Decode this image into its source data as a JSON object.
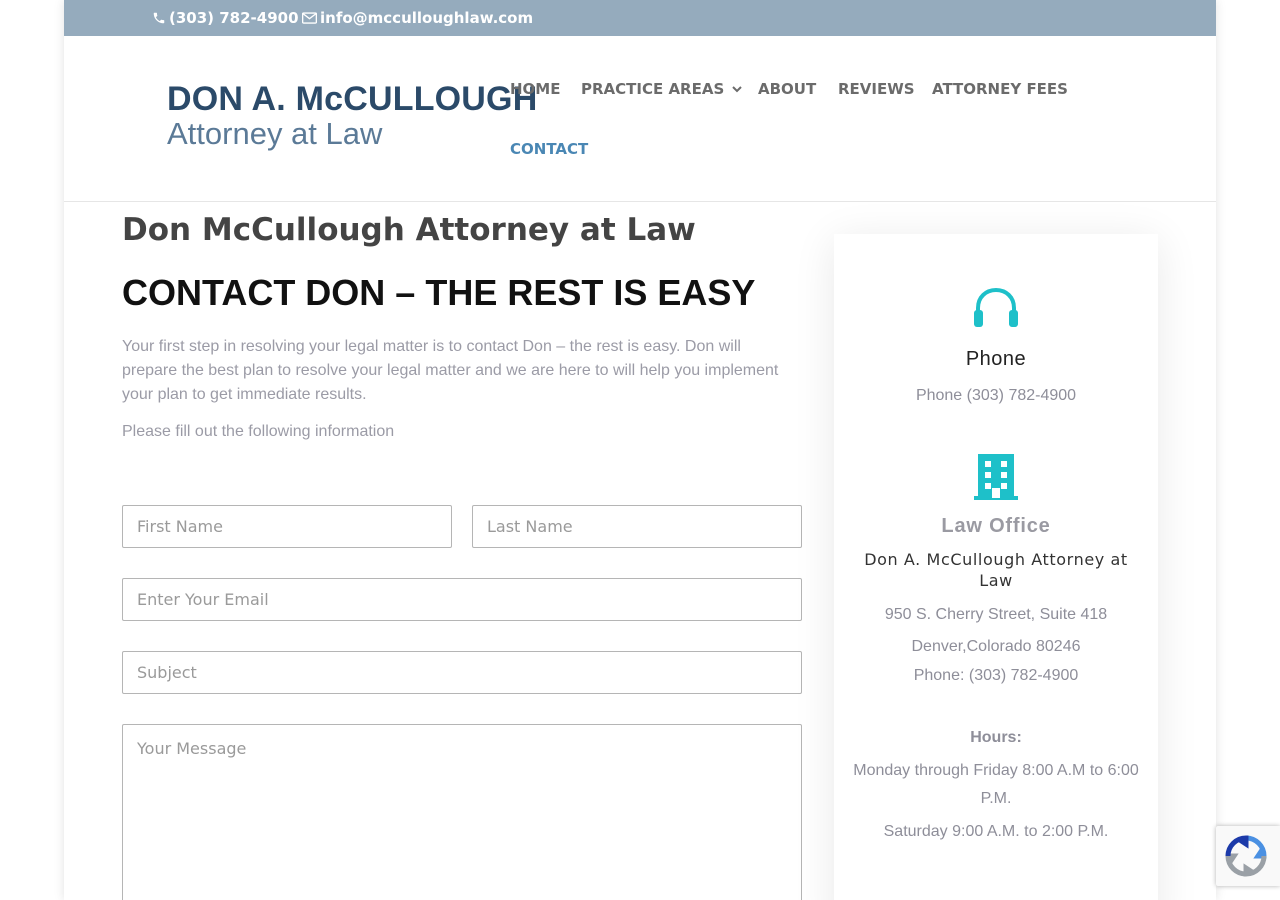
{
  "topbar": {
    "phone": "(303) 782-4900",
    "email": "info@mcculloughlaw.com"
  },
  "logo": {
    "line1": "DON A. McCULLOUGH",
    "line2": "Attorney at Law"
  },
  "nav": {
    "home": "HOME",
    "practice_areas": "PRACTICE AREAS",
    "about": "ABOUT",
    "reviews": "REVIEWS",
    "attorney_fees": "ATTORNEY FEES",
    "contact": "CONTACT"
  },
  "main": {
    "page_title": "Don McCullough Attorney at Law",
    "heading": "CONTACT DON – THE REST IS EASY",
    "intro": "Your first step in resolving your legal matter is to contact Don – the rest is easy. Don will prepare the best plan to resolve your legal matter and we are here to will help you implement your plan to get immediate results.",
    "instructions": "Please fill out the following information"
  },
  "form": {
    "first_name_placeholder": "First Name",
    "last_name_placeholder": "Last Name",
    "email_placeholder": "Enter Your Email",
    "subject_placeholder": "Subject",
    "message_placeholder": "Your Message"
  },
  "sidebar": {
    "phone_title": "Phone",
    "phone_text": "Phone (303) 782-4900",
    "office_title": "Law Office",
    "office_name": "Don A. McCullough Attorney at Law",
    "address_line1": "950 S. Cherry Street, Suite 418",
    "address_line2": "Denver,Colorado 80246",
    "office_phone": "Phone: (303) 782-4900",
    "hours_label": "Hours:",
    "hours_weekday": "Monday through Friday 8:00 A.M to 6:00 P.M.",
    "hours_saturday": "Saturday 9:00 A.M. to 2:00 P.M."
  },
  "colors": {
    "topbar": "#95abbd",
    "accent": "#1ec0c9",
    "nav_active": "#4a87b4",
    "logo_dark": "#2b4a69"
  },
  "icons": {
    "phone": "phone-icon",
    "email": "envelope-icon",
    "headset": "headset-icon",
    "building": "building-icon",
    "caret": "chevron-down-icon",
    "recaptcha": "recaptcha-icon"
  }
}
